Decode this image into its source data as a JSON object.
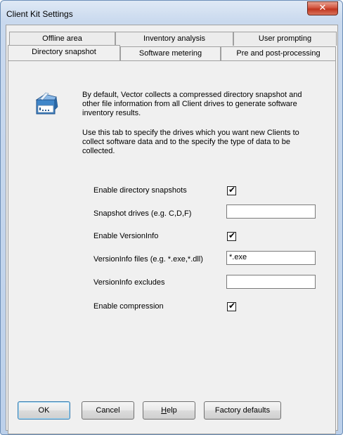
{
  "window": {
    "title": "Client Kit Settings",
    "close_glyph": "✕"
  },
  "tabs_row1": [
    {
      "label": "Offline area"
    },
    {
      "label": "Inventory analysis"
    },
    {
      "label": "User prompting"
    }
  ],
  "tabs_row2": [
    {
      "label": "Directory snapshot",
      "active": true
    },
    {
      "label": "Software metering"
    },
    {
      "label": "Pre and post-processing"
    }
  ],
  "description": {
    "icon": "installer-box-icon",
    "para1": "By default, Vector collects a compressed directory snapshot and other file information from all Client drives to generate software inventory results.",
    "para2": "Use this tab to specify the drives which you want new Clients to collect software data and to the specify the type of data to be collected."
  },
  "settings": {
    "enable_snapshots": {
      "label": "Enable directory snapshots",
      "checked": true
    },
    "snapshot_drives": {
      "label": "Snapshot drives (e.g. C,D,F)",
      "value": ""
    },
    "enable_versioninfo": {
      "label": "Enable VersionInfo",
      "checked": true
    },
    "versioninfo_files": {
      "label": "VersionInfo files (e.g. *.exe,*.dll)",
      "value": "*.exe"
    },
    "versioninfo_excludes": {
      "label": "VersionInfo excludes",
      "value": ""
    },
    "enable_compression": {
      "label": "Enable compression",
      "checked": true
    }
  },
  "buttons": {
    "ok": "OK",
    "cancel": "Cancel",
    "help_prefix": "",
    "help_mnemonic": "H",
    "help_rest": "elp",
    "factory": "Factory defaults"
  },
  "check_glyph": "✔"
}
